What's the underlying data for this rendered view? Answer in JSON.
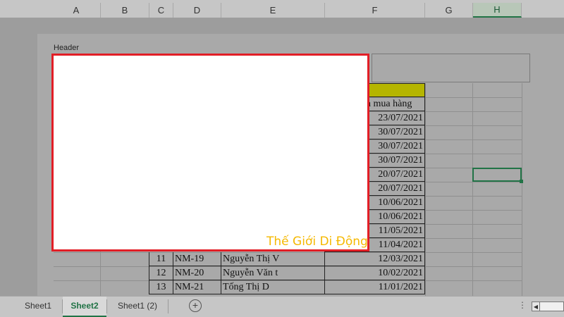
{
  "columns": [
    "A",
    "B",
    "C",
    "D",
    "E",
    "F",
    "G",
    "H"
  ],
  "selected_column": "H",
  "header_label": "Header",
  "date_column_header": "n mua hàng",
  "dates_upper": [
    "23/07/2021",
    "30/07/2021",
    "30/07/2021",
    "30/07/2021",
    "20/07/2021",
    "20/07/2021",
    "10/06/2021",
    "10/06/2021",
    "11/05/2021",
    "11/04/2021"
  ],
  "rows": [
    {
      "num": "11",
      "code": "NM-19",
      "name": "Nguyễn Thị V",
      "date": "12/03/2021"
    },
    {
      "num": "12",
      "code": "NM-20",
      "name": "Nguyễn Văn t",
      "date": "10/02/2021"
    },
    {
      "num": "13",
      "code": "NM-21",
      "name": "Tống Thị D",
      "date": "11/01/2021"
    }
  ],
  "watermark": "Thế Giới Di Động",
  "tabs": [
    "Sheet1",
    "Sheet2",
    "Sheet1 (2)"
  ],
  "active_tab": "Sheet2",
  "add_sheet_glyph": "+",
  "tabbar_ellipsis": "⋮",
  "scroll_left_glyph": "◀",
  "colors": {
    "accent": "#217346",
    "highlight_border": "#e21e26",
    "watermark": "#f5b800",
    "yellow_fill": "#b5b500"
  }
}
